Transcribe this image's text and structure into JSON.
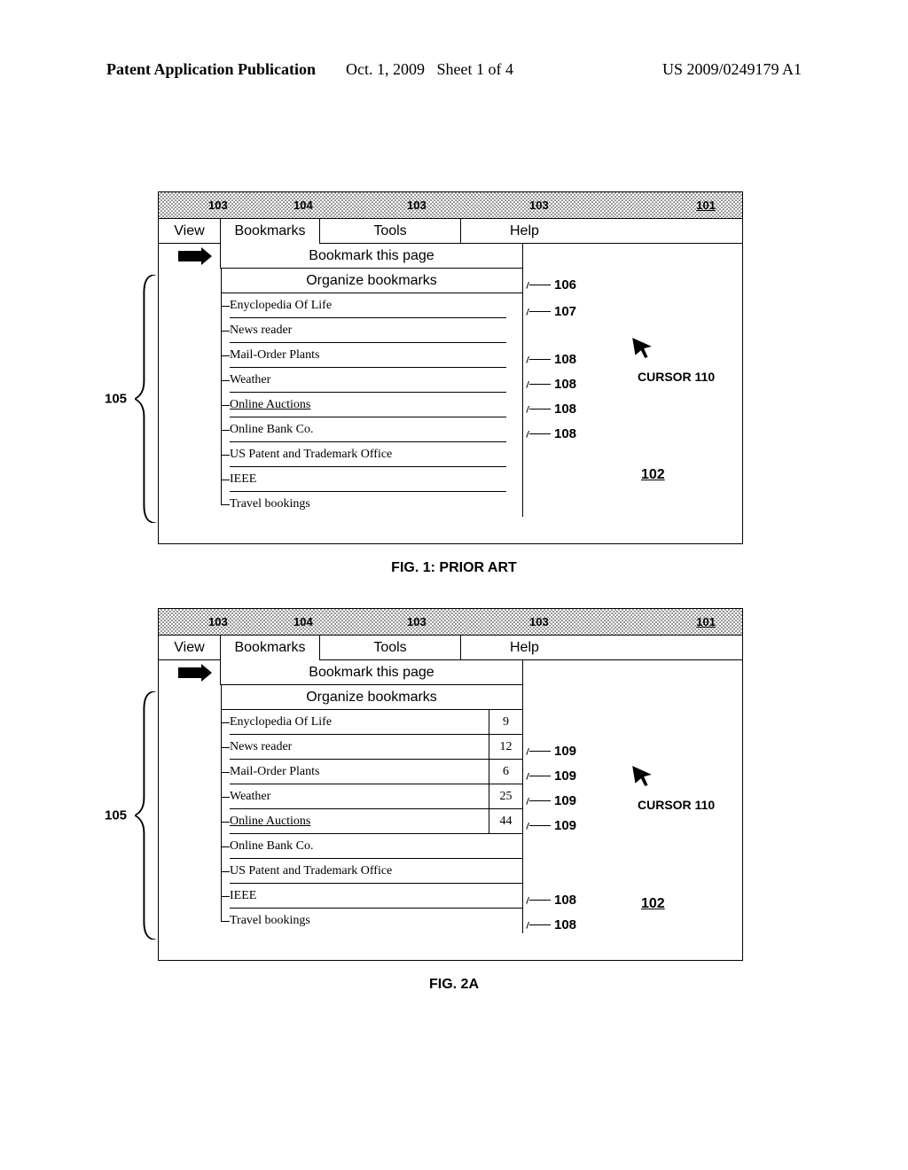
{
  "header": {
    "publication": "Patent Application Publication",
    "date": "Oct. 1, 2009",
    "sheet": "Sheet 1 of 4",
    "patent_num": "US 2009/0249179 A1"
  },
  "menu": {
    "view": "View",
    "bookmarks": "Bookmarks",
    "tools": "Tools",
    "help": "Help"
  },
  "actions": {
    "bookmark_page": "Bookmark this page",
    "organize": "Organize bookmarks"
  },
  "bookmarks": {
    "items": [
      {
        "label": "Enyclopedia Of Life"
      },
      {
        "label": "News reader"
      },
      {
        "label": "Mail-Order Plants"
      },
      {
        "label": "Weather"
      },
      {
        "label": "Online Auctions"
      },
      {
        "label": "Online Bank Co."
      },
      {
        "label": "US Patent and Trademark Office"
      },
      {
        "label": "IEEE"
      },
      {
        "label": "Travel bookings"
      }
    ],
    "counted_items": [
      {
        "label": "Enyclopedia Of Life",
        "count": "9"
      },
      {
        "label": "News reader",
        "count": "12"
      },
      {
        "label": "Mail-Order Plants",
        "count": "6"
      },
      {
        "label": "Weather",
        "count": "25"
      },
      {
        "label": "Online Auctions",
        "count": "44"
      },
      {
        "label": "Online Bank Co."
      },
      {
        "label": "US Patent and Trademark Office"
      },
      {
        "label": "IEEE"
      },
      {
        "label": "Travel bookings"
      }
    ]
  },
  "refs": {
    "r101": "101",
    "r102": "102",
    "r103": "103",
    "r104": "104",
    "r105": "105",
    "r106": "106",
    "r107": "107",
    "r108": "108",
    "r109": "109",
    "cursor": "CURSOR 110"
  },
  "captions": {
    "fig1": "FIG. 1: PRIOR ART",
    "fig2": "FIG. 2A"
  }
}
